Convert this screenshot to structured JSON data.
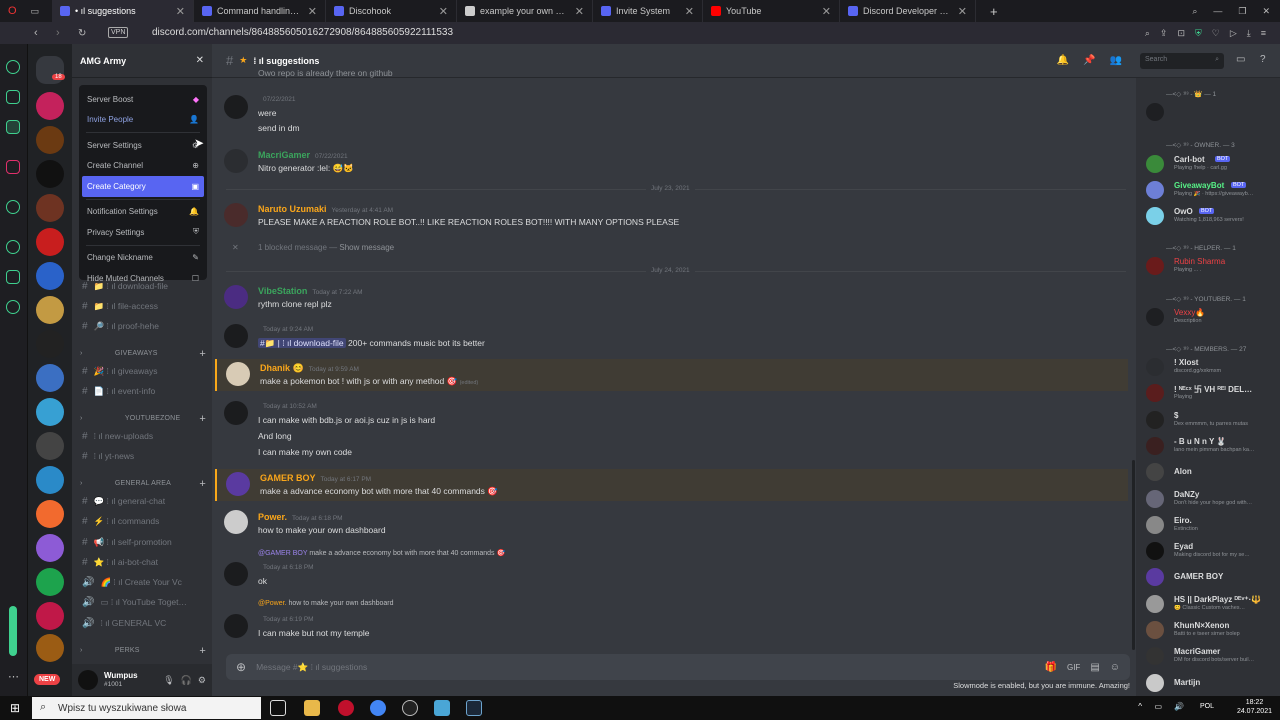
{
  "browser": {
    "tabs": [
      {
        "label": "• ıl suggestions",
        "color": "#5865f2",
        "active": true
      },
      {
        "label": "Command handling | Disc…",
        "color": "#5865f2"
      },
      {
        "label": "Discohook",
        "color": "#5865f2"
      },
      {
        "label": "example your own websid…",
        "color": "#cccccc"
      },
      {
        "label": "Invite System",
        "color": "#5865f2"
      },
      {
        "label": "YouTube",
        "color": "#ff0000"
      },
      {
        "label": "Discord Developer Portal…",
        "color": "#5865f2"
      }
    ],
    "new_tab": "+",
    "vpn": "VPN",
    "url": "discord.com/channels/864885605016272908/864885605922111533"
  },
  "server": {
    "name": "AMG Army",
    "close": "✕",
    "menu": [
      {
        "label": "Server Boost",
        "icon": "◆",
        "style": ""
      },
      {
        "label": "Invite People",
        "icon": "👤",
        "style": "blue"
      },
      {
        "label": "Server Settings",
        "icon": "⚙",
        "style": ""
      },
      {
        "label": "Create Channel",
        "icon": "⊕",
        "style": ""
      },
      {
        "label": "Create Category",
        "icon": "▣",
        "style": "hl"
      },
      {
        "label": "Notification Settings",
        "icon": "🔔",
        "style": ""
      },
      {
        "label": "Privacy Settings",
        "icon": "⛨",
        "style": ""
      },
      {
        "label": "Change Nickname",
        "icon": "✎",
        "style": ""
      },
      {
        "label": "Hide Muted Channels",
        "icon": "☐",
        "style": ""
      }
    ],
    "channels_top": [
      {
        "label": "📁 ⁞ ıl download-file"
      },
      {
        "label": "📁 ⁞ ıl file-access"
      },
      {
        "label": "🔎 ⁞ ıl proof-hehe"
      }
    ],
    "cat_giveaways": "GIVEAWAYS",
    "giveaways": [
      {
        "label": "🎉 ⁞ ıl giveaways"
      },
      {
        "label": "📄 ⁞ ıl event-info"
      }
    ],
    "cat_youtube": "YOUTUBEZONE",
    "youtube": [
      {
        "label": "⁞ ıl new-uploads"
      },
      {
        "label": "⁞ ıl yt-news"
      }
    ],
    "cat_general": "GENERAL AREA",
    "general": [
      {
        "label": "💬 ⁞ ıl general-chat"
      },
      {
        "label": "⚡ ⁞ ıl commands"
      },
      {
        "label": "📢 ⁞ ıl self-promotion"
      },
      {
        "label": "⭐ ⁞ ıl ai-bot-chat"
      },
      {
        "label": "🌈 ⁞ ıl Create Your Vc"
      },
      {
        "label": "▭ ⁞ ıl YouTube Toget…"
      },
      {
        "label": "⁞ ıl GENERAL VC"
      }
    ],
    "cat_perks": "PERKS",
    "user": {
      "name": "Wumpus",
      "tag": "#1001",
      "new": "NEW"
    }
  },
  "channel": {
    "name": "⁞ ıl suggestions",
    "search": "Search",
    "composer_placeholder": "Message #⭐ ⁞ ıl suggestions",
    "slowmode": "Slowmode is enabled, but you are immune. Amazing!"
  },
  "messages": {
    "m1_ts": "07/22/2021",
    "m1_l1": "were",
    "m1_l2": "send in dm",
    "m2_user": "MacriGamer",
    "m2_ts": "07/22/2021",
    "m2_text": "Nitro generator :lel: 😅🐱",
    "div1": "July 23, 2021",
    "m3_user": "Naruto Uzumaki",
    "m3_ts": "Yesterday at 4:41 AM",
    "m3_text": "PLEASE MAKE A REACTION ROLE BOT..!! LIKE REACTION ROLES BOT!!!! WITH MANY OPTIONS PLEASE",
    "blocked": "1 blocked message —",
    "show": "Show message",
    "div2": "July 24, 2021",
    "m4_user": "VibeStation",
    "m4_ts": "Today at 7:22 AM",
    "m4_text": "rythm clone repl plz",
    "m5_ts": "Today at 9:24 AM",
    "m5_chan": "#📁 | ⁞ ıl download-file",
    "m5_text": "200+ commands music bot its better",
    "m6_user": "Dhanik 😊",
    "m6_ts": "Today at 9:59 AM",
    "m6_text": "make a pokemon bot ! with js or with any method 🎯",
    "m6_edit": "(edited)",
    "m7_ts": "Today at 10:52 AM",
    "m7_l1": "I can make with bdb.js or aoi.js cuz in js is hard",
    "m7_l2": "And long",
    "m7_l3": "I can make my own code",
    "m8_user": "GAMER BOY",
    "m8_ts": "Today at 6:17 PM",
    "m8_text": "make a advance economy bot with more that 40 commands 🎯",
    "m9_user": "Power.",
    "m9_ts": "Today at 6:18 PM",
    "m9_text": "how to make your own dashboard",
    "r1_user": "@GAMER BOY",
    "r1_text": "make a advance economy bot with more that 40 commands 🎯",
    "m10_ts": "Today at 6:18 PM",
    "m10_text": "ok",
    "r2_user": "@Power.",
    "r2_text": "how to make your own dashboard",
    "m11_ts": "Today at 6:19 PM",
    "m11_text": "I can make but not my temple"
  },
  "members": {
    "g1": "—<◇ ¹ᴵ³ - 👑 — 1",
    "g2": "—<◇ ¹ᴵ³ - OWNER. — 3",
    "carl": "Carl-bot",
    "carl_s": "Playing !help · carl.gg",
    "give": "GiveawayBot",
    "give_s": "Playing 🎉 · https://giveawayb…",
    "owo": "OwO",
    "owo_s": "Watching 1,818,963 servers!",
    "bot": "BOT",
    "g3": "—<◇ ¹ᴵ³ - HELPER. — 1",
    "rubin": "Rubin Sharma",
    "rubin_s": "Playing ... .",
    "g4": "—<◇ ¹ᴵ³ - YOUTUBER. — 1",
    "yt": "Vexxy🔥",
    "yt_s": "Description",
    "g5": "—<◇ ¹ᴵ³ - MEMBERS. — 27",
    "list": [
      {
        "n": "! Xlost",
        "s": "discord.gg/xxkmxm",
        "c": "#dcddde"
      },
      {
        "n": "! ᴺᴱᶜˣ 卐 VH ᴿᴱᴵ DEL…",
        "s": "Playing",
        "c": "#dcddde"
      },
      {
        "n": "$",
        "s": "Dex emmmm, tu parres mutas",
        "c": "#dcddde"
      },
      {
        "n": "- B u N n Y 🐰",
        "s": "lano mein pimman bachpan ka…",
        "c": "#dcddde"
      },
      {
        "n": "Alon",
        "s": "",
        "c": "#dcddde"
      },
      {
        "n": "DaNZy",
        "s": "Don't hide your hope god with…",
        "c": "#dcddde"
      },
      {
        "n": "Eiro.",
        "s": "Extinction",
        "c": "#dcddde"
      },
      {
        "n": "Eyad",
        "s": "Making discord bot for my se…",
        "c": "#dcddde"
      },
      {
        "n": "GAMER BOY",
        "s": "",
        "c": "#dcddde"
      },
      {
        "n": "HS || DarkPlayz ᴰᴱᵛ⁺·🔱",
        "s": "😊 Classic Custom vaches…",
        "c": "#dcddde"
      },
      {
        "n": "KhunN×Xenon",
        "s": "Batti to e tseer sirner bolep",
        "c": "#dcddde"
      },
      {
        "n": "MacriGamer",
        "s": "DM for discord bots/server buil…",
        "c": "#dcddde"
      },
      {
        "n": "Martijn",
        "s": "",
        "c": "#dcddde"
      }
    ]
  },
  "taskbar": {
    "search": "Wpisz tu wyszukiwane słowa",
    "lang": "POL",
    "time": "18:22",
    "date": "24.07.2021"
  }
}
